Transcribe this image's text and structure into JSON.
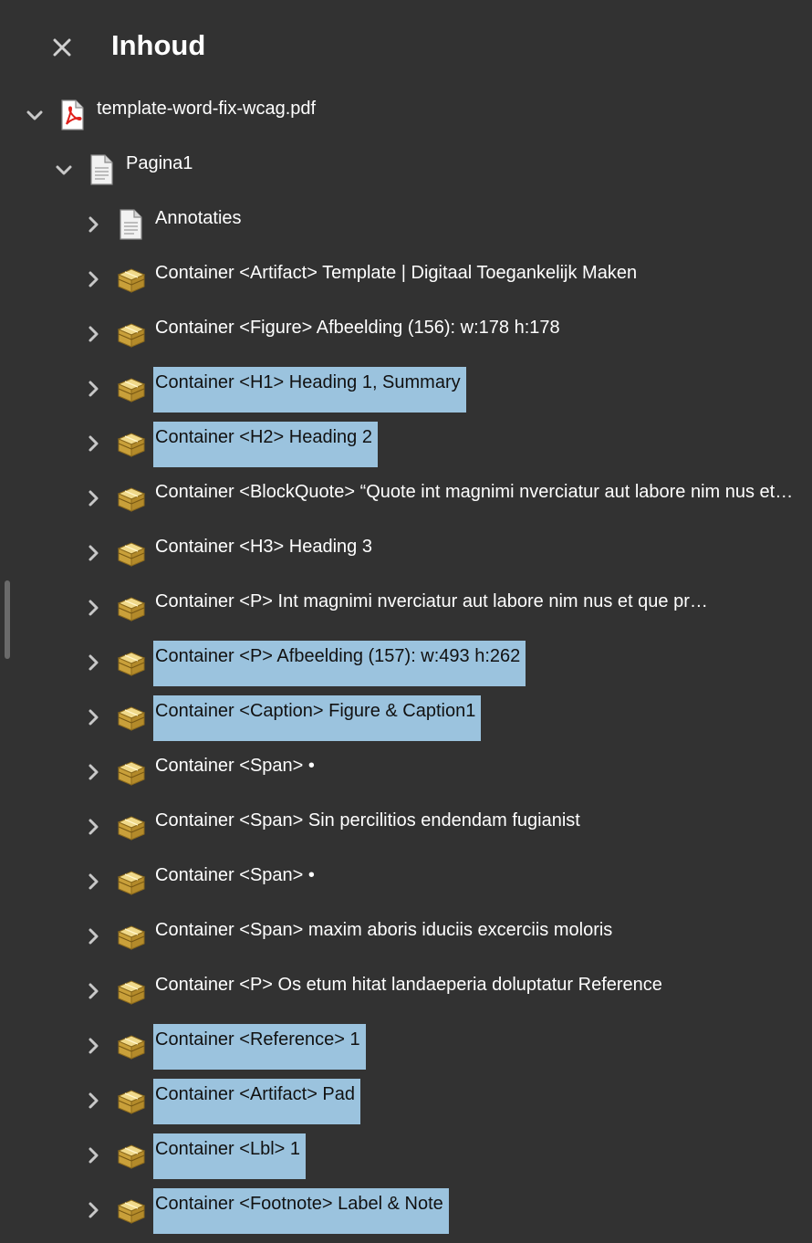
{
  "panel": {
    "title": "Inhoud",
    "close_icon": "close-icon"
  },
  "tree": {
    "root": {
      "label": "template-word-fix-wcag.pdf",
      "icon": "pdf-icon",
      "expanded": true
    },
    "page": {
      "label": "Pagina1",
      "icon": "page-icon",
      "expanded": true
    },
    "items": [
      {
        "label": "Annotaties",
        "icon": "page-icon",
        "highlighted": false
      },
      {
        "label": "Container <Artifact> Template | Digitaal Toegankelijk Maken",
        "icon": "container-icon",
        "highlighted": false
      },
      {
        "label": "Container <Figure> Afbeelding (156): w:178 h:178",
        "icon": "container-icon",
        "highlighted": false
      },
      {
        "label": "Container <H1> Heading 1, Summary",
        "icon": "container-icon",
        "highlighted": true
      },
      {
        "label": "Container <H2> Heading 2",
        "icon": "container-icon",
        "highlighted": true
      },
      {
        "label": "Container <BlockQuote> “Quote int magnimi nverciatur aut labore nim nus et…",
        "icon": "container-icon",
        "highlighted": false
      },
      {
        "label": "Container <H3> Heading 3",
        "icon": "container-icon",
        "highlighted": false
      },
      {
        "label": "Container <P> Int magnimi nverciatur aut labore nim nus et que pr…",
        "icon": "container-icon",
        "highlighted": false
      },
      {
        "label": "Container <P> Afbeelding (157): w:493 h:262",
        "icon": "container-icon",
        "highlighted": true
      },
      {
        "label": "Container <Caption> Figure & Caption1",
        "icon": "container-icon",
        "highlighted": true
      },
      {
        "label": "Container <Span> •",
        "icon": "container-icon",
        "highlighted": false
      },
      {
        "label": "Container <Span> Sin percilitios endendam fugianist",
        "icon": "container-icon",
        "highlighted": false
      },
      {
        "label": "Container <Span> •",
        "icon": "container-icon",
        "highlighted": false
      },
      {
        "label": "Container <Span> maxim aboris iduciis excerciis moloris",
        "icon": "container-icon",
        "highlighted": false
      },
      {
        "label": "Container <P> Os etum hitat landaeperia doluptatur Reference",
        "icon": "container-icon",
        "highlighted": false
      },
      {
        "label": "Container <Reference> 1",
        "icon": "container-icon",
        "highlighted": true
      },
      {
        "label": "Container <Artifact> Pad",
        "icon": "container-icon",
        "highlighted": true
      },
      {
        "label": "Container <Lbl> 1",
        "icon": "container-icon",
        "highlighted": true
      },
      {
        "label": "Container <Footnote> Label & Note",
        "icon": "container-icon",
        "highlighted": true
      }
    ]
  },
  "colors": {
    "background": "#323232",
    "highlight": "#9bc3de",
    "text": "#ffffff",
    "highlight_text": "#111111"
  }
}
